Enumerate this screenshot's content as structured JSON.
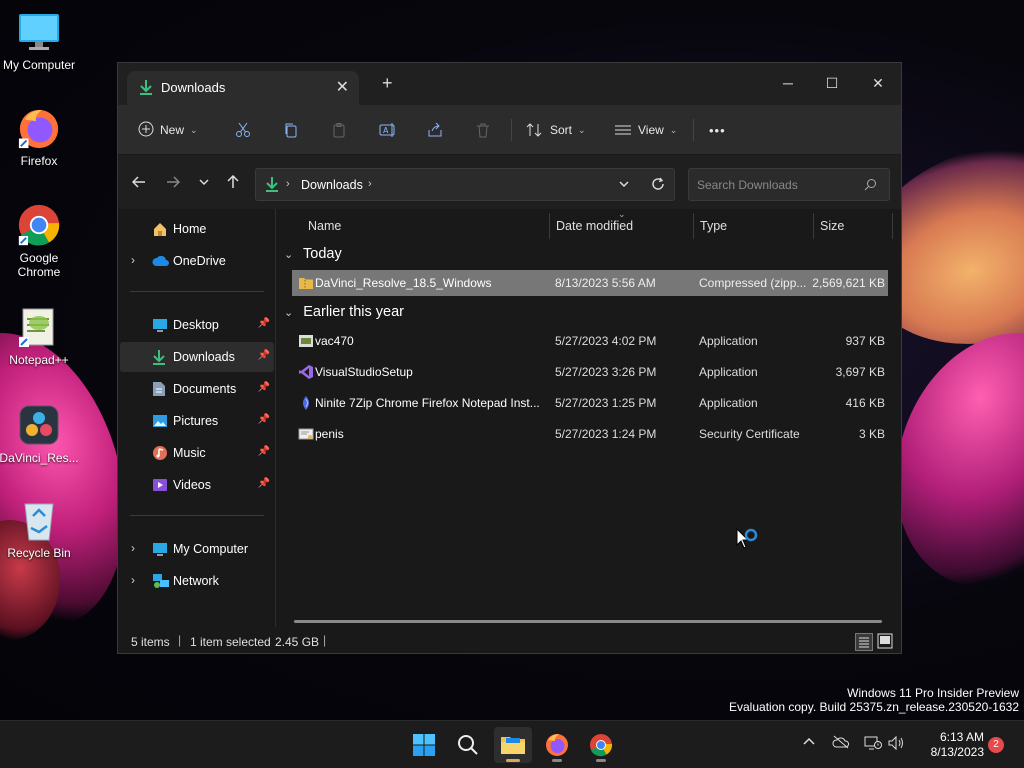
{
  "desktop": {
    "icons": [
      {
        "label": "My Computer",
        "icon": "monitor-icon"
      },
      {
        "label": "Firefox",
        "icon": "firefox-icon"
      },
      {
        "label": "Google Chrome",
        "icon": "chrome-icon"
      },
      {
        "label": "Notepad++",
        "icon": "notepadpp-icon"
      },
      {
        "label": "DaVinci_Res...",
        "icon": "davinci-icon"
      },
      {
        "label": "Recycle Bin",
        "icon": "recycle-bin-icon"
      }
    ]
  },
  "explorer": {
    "tab": {
      "label": "Downloads",
      "new_tab": "+"
    },
    "window_controls": {
      "minimize": "─",
      "maximize": "☐",
      "close": "✕"
    },
    "toolbar": {
      "new_label": "New",
      "sort_label": "Sort",
      "view_label": "View",
      "more_label": "•••"
    },
    "address": {
      "segment": "Downloads",
      "search_placeholder": "Search Downloads"
    },
    "nav": {
      "items": [
        {
          "label": "Home"
        },
        {
          "label": "OneDrive"
        },
        {
          "label": "Desktop"
        },
        {
          "label": "Downloads"
        },
        {
          "label": "Documents"
        },
        {
          "label": "Pictures"
        },
        {
          "label": "Music"
        },
        {
          "label": "Videos"
        },
        {
          "label": "My Computer"
        },
        {
          "label": "Network"
        }
      ]
    },
    "columns": {
      "name": "Name",
      "date": "Date modified",
      "type": "Type",
      "size": "Size"
    },
    "groups": [
      {
        "title": "Today",
        "files": [
          {
            "name": "DaVinci_Resolve_18.5_Windows",
            "date": "8/13/2023 5:56 AM",
            "type": "Compressed (zipp...",
            "size": "2,569,621 KB",
            "icon": "zip-folder-icon",
            "selected": true
          }
        ]
      },
      {
        "title": "Earlier this year",
        "files": [
          {
            "name": "vac470",
            "date": "5/27/2023 4:02 PM",
            "type": "Application",
            "size": "937 KB",
            "icon": "app-icon"
          },
          {
            "name": "VisualStudioSetup",
            "date": "5/27/2023 3:26 PM",
            "type": "Application",
            "size": "3,697 KB",
            "icon": "visual-studio-icon"
          },
          {
            "name": "Ninite 7Zip Chrome Firefox Notepad Inst...",
            "date": "5/27/2023 1:25 PM",
            "type": "Application",
            "size": "416 KB",
            "icon": "ninite-icon"
          },
          {
            "name": "penis",
            "date": "5/27/2023 1:24 PM",
            "type": "Security Certificate",
            "size": "3 KB",
            "icon": "certificate-icon"
          }
        ]
      }
    ],
    "status": {
      "items": "5 items",
      "selected": "1 item selected",
      "size": "2.45 GB"
    }
  },
  "watermark": {
    "line1": "Windows 11 Pro Insider Preview",
    "line2": "Evaluation copy. Build 25375.zn_release.230520-1632"
  },
  "taskbar": {
    "clock_time": "6:13 AM",
    "clock_date": "8/13/2023",
    "notification_count": "2"
  }
}
